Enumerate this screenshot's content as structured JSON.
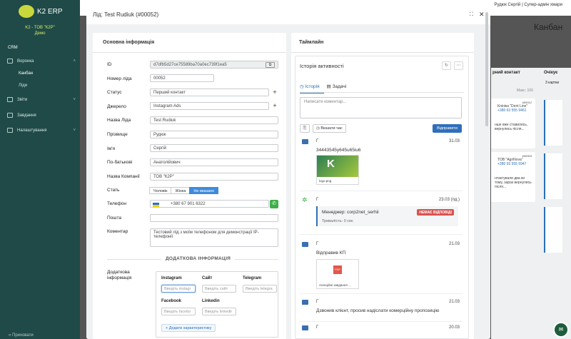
{
  "app": {
    "logo_text": "K2 ERP",
    "org": "K2 - ТОВ \"К2Р\"",
    "org_sub": "Демо",
    "user": "Рудюк Сергій | Супер-адмін хмари"
  },
  "sidebar": {
    "section": "CRM",
    "items": [
      {
        "label": "Воронка"
      },
      {
        "label": "Канбан"
      },
      {
        "label": "Ліди"
      },
      {
        "label": "Звіти"
      },
      {
        "label": "Завдання"
      },
      {
        "label": "Налаштування"
      }
    ],
    "collapse": "Приховати"
  },
  "background": {
    "page_title": "Канбан",
    "col1": "рний контакт",
    "col2": "Очікує",
    "col2_sub": "3 картки",
    "max": "Макс: 100",
    "cards": [
      {
        "id": "#00012",
        "name": "Клініка \"Dent Line\"",
        "phone": "+380 63 555 9461",
        "note": "нше вже ставились, вернулись після..."
      },
      {
        "id": "#00003",
        "name": "ТОВ \"AgriNova\"",
        "phone": "+380 93 555 5947",
        "note": "нтактували два ки тому, зараз вернулись після..."
      }
    ]
  },
  "modal": {
    "title": "Лід: Test Rudiuk (#00052)",
    "left_title": "Основна інформація",
    "right_title": "Таймлайн",
    "fields": {
      "id_label": "ID",
      "id_value": "d7dfb5d27ce75589ba70a0ec739f1ea5",
      "number_label": "Номер ліда",
      "number_value": "00052",
      "status_label": "Статус",
      "status_value": "Перший контакт",
      "source_label": "Джерело",
      "source_value": "Instagram Ads",
      "lead_name_label": "Назва Ліда",
      "lead_name_value": "Test Rudiuk",
      "surname_label": "Прізвище",
      "surname_value": "Рудюк",
      "name_label": "Ім'я",
      "name_value": "Сергій",
      "patronymic_label": "По-батькові",
      "patronymic_value": "Анатолійович",
      "company_label": "Назва Компанії",
      "company_value": "ТОВ \"К2Р\"",
      "gender_label": "Стать",
      "gender_options": [
        "Чоловік",
        "Жінка",
        "Не вказано"
      ],
      "gender_selected": "Не вказано",
      "phone_label": "Телефон",
      "phone_value": "+380 67 901 6322",
      "email_label": "Пошта",
      "email_value": "",
      "comment_label": "Коментар",
      "comment_value": "Тестовий лід з моїм телефоном для демонстрації IP-телефонії"
    },
    "extra": {
      "divider": "ДОДАТКОВА ІНФОРМАЦІЯ",
      "label": "Додаткова інформація",
      "instagram": "Instagram",
      "instagram_ph": "Введіть instagr",
      "site": "Сайт",
      "site_ph": "Введіть сайт",
      "telegram": "Telegram",
      "telegram_ph": "Введіть telegra",
      "facebook": "Facebook",
      "facebook_ph": "Введіть facebo",
      "linkedin": "Linkedin",
      "linkedin_ph": "Введіть linkedir",
      "add": "+ Додати характеристику"
    },
    "activity": {
      "title": "Історія активності",
      "tab_history": "Історія",
      "tab_tasks": "Задачі",
      "comment_ph": "Написати коментар...",
      "time_btn": "Вказати час",
      "send": "Відправити",
      "entries": [
        {
          "author": "Г",
          "time": "31.03",
          "text": "34443545y645u65iu6",
          "file": "logo.png"
        },
        {
          "author": "Г",
          "time": "23.03 (пд.)",
          "manager": "Менеджер: corp2net_serhii",
          "duration": "Тривалість: 0 сек",
          "badge": "НЕМАЄ ВІДПОВІДІ"
        },
        {
          "author": "Г",
          "time": "21.03",
          "text": "Відправив КП",
          "file": "Агенційні завдання ..."
        },
        {
          "author": "Г",
          "time": "21.03",
          "text": "Дзвонив клієнт, просив надіслати комерційну пропозицію"
        },
        {
          "author": "Г",
          "time": "20.03"
        }
      ]
    }
  }
}
